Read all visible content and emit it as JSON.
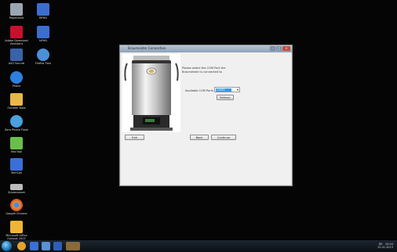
{
  "desktop": {
    "icons": [
      {
        "label": "Papierkorb",
        "icon": "recycle-bin-icon",
        "color": "#9aa6b2"
      },
      {
        "label": "Adobe Download\nAssistant",
        "icon": "adobe-icon",
        "color": "#c8102e"
      },
      {
        "label": "AVG Secure",
        "icon": "avg-icon",
        "color": "#3a62a8"
      },
      {
        "label": "Phone",
        "icon": "phone-icon",
        "color": "#2f7fe0"
      },
      {
        "label": "Outlook Tools",
        "icon": "folder-icon",
        "color": "#e8b84a"
      },
      {
        "label": "Zero Phone Flash",
        "icon": "zero-icon",
        "color": "#4aa0e0"
      },
      {
        "label": "MiniTool",
        "icon": "minitool-icon",
        "color": "#6abf4b"
      },
      {
        "label": "TechCall",
        "icon": "techcall-icon",
        "color": "#3a6fd8"
      },
      {
        "label": "Stickersheet",
        "icon": "sticker-icon",
        "color": "#bbbbbb"
      },
      {
        "label": "Google Chrome",
        "icon": "chrome-icon",
        "color": "#e4a22b"
      },
      {
        "label": "Microsoft Office\nOutlook 2007",
        "icon": "outlook-icon",
        "color": "#f0b43a"
      },
      {
        "label": "BPHD",
        "icon": "app-icon",
        "color": "#3c6ed0"
      },
      {
        "label": "NPHD",
        "icon": "app2-icon",
        "color": "#3c6ed0"
      },
      {
        "label": "Firefox Flair",
        "icon": "firefox-icon",
        "color": "#4a90d9"
      }
    ]
  },
  "window": {
    "title": "Braumeister Connection",
    "prompt": "Please select the COM Port the Braumeister is connected to",
    "com_label": "Available COM Ports",
    "com_value": "COM3",
    "refresh_label": "Refresh",
    "exit_label": "Exit",
    "back_label": "Back",
    "continue_label": "Continue"
  },
  "taskbar": {
    "tray_time": "10:04",
    "tray_date": "12.01.2013",
    "tray_lang": "DE"
  }
}
